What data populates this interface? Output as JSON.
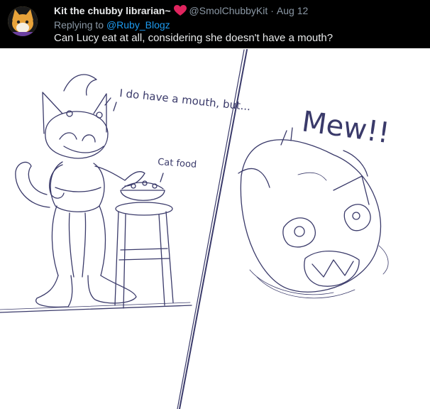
{
  "tweet": {
    "author_name": "Kit the chubby librarian~",
    "author_handle": "@SmolChubbyKit",
    "separator": "·",
    "date": "Aug 12",
    "replying_prefix": "Replying to",
    "reply_to_handle": "@Ruby_Blogz",
    "text": "Can Lucy eat at all, considering she doesn't have a mouth?"
  },
  "icons": {
    "avatar": "cat-avatar-icon",
    "heart": "heart-icon"
  },
  "colors": {
    "header_bg": "#000000",
    "name_text": "#e7e9ea",
    "muted_text": "#8b98a5",
    "link": "#1d9bf0",
    "heart": "#e0245e",
    "sketch_line": "#3a3a6a"
  },
  "artwork": {
    "speech_left": "I do have a mouth, but...",
    "label_cat_food": "Cat food",
    "speech_right": "Mew!!"
  }
}
